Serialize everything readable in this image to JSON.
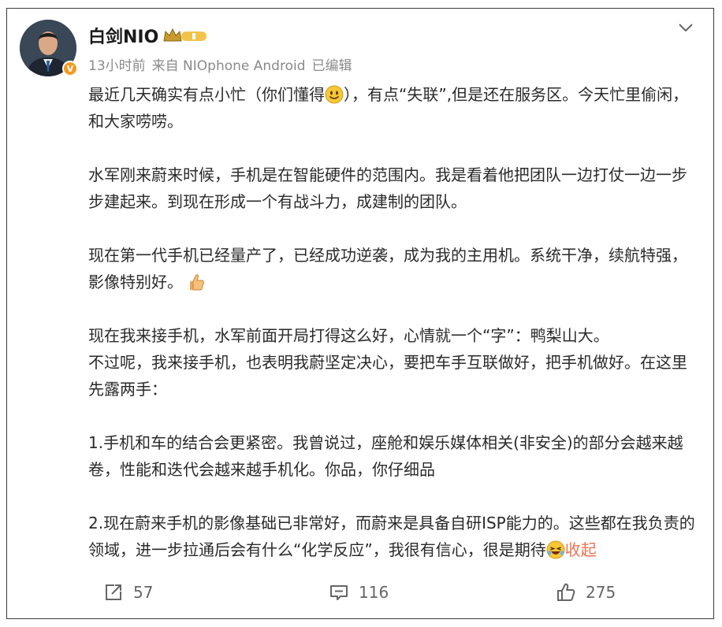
{
  "post": {
    "author": "白剑NIO",
    "time": "13小时前",
    "source": "来自 NIOphone Android",
    "edited": "已编辑",
    "verified_badge": "V",
    "paragraphs": {
      "p1a": "最近几天确实有点小忙（你们懂得",
      "p1b": "），有点“失联”,但是还在服务区。今天忙里偷闲，和大家唠唠。",
      "p2": "水军刚来蔚来时候，手机是在智能硬件的范围内。我是看着他把团队一边打仗一边一步步建起来。到现在形成一个有战斗力，成建制的团队。",
      "p3": "现在第一代手机已经量产了，已经成功逆袭，成为我的主用机。系统干净，续航特强，影像特别好。",
      "p4a": "现在我来接手机，水军前面开局打得这么好，心情就一个“字”：鸭梨山大。",
      "p4b": "不过呢，我来接手机，也表明我蔚坚定决心，要把车手互联做好，把手机做好。在这里先露两手：",
      "p5": "1.手机和车的结合会更紧密。我曾说过，座舱和娱乐媒体相关(非安全)的部分会越来越卷，性能和迭代会越来越手机化。你品，你仔细品",
      "p6": "2.现在蔚来手机的影像基础已非常好，而蔚来是具备自研ISP能力的。这些都在我负责的领域，进一步拉通后会有什么“化学反应”，我很有信心，很是期待"
    },
    "collapse_label": "收起"
  },
  "actions": {
    "repost_count": "57",
    "comment_count": "116",
    "like_count": "275"
  },
  "colors": {
    "accent": "#eb7350",
    "badge": "#f59a23",
    "meta_text": "#8a8a8a"
  },
  "icons": [
    "chevron-down-icon",
    "share-icon",
    "comment-icon",
    "thumbs-up-icon",
    "crown-icon",
    "smile-emoji-icon",
    "laughing-emoji-icon",
    "thumb-emoji-icon"
  ]
}
